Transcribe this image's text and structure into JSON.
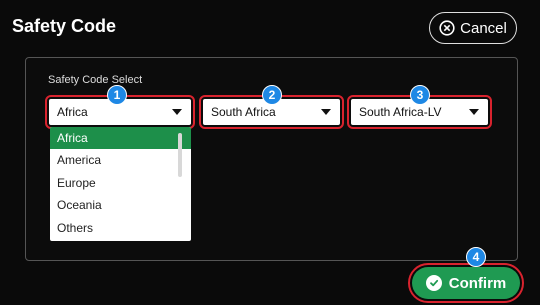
{
  "header": {
    "title": "Safety Code",
    "cancel_label": "Cancel"
  },
  "panel": {
    "label": "Safety Code  Select"
  },
  "selects": [
    {
      "value": "Africa",
      "badge": "1"
    },
    {
      "value": "South Africa",
      "badge": "2"
    },
    {
      "value": "South Africa-LV",
      "badge": "3"
    }
  ],
  "dropdown": {
    "options": [
      "Africa",
      "America",
      "Europe",
      "Oceania",
      "Others"
    ],
    "selected": "Africa"
  },
  "confirm": {
    "label": "Confirm",
    "badge": "4"
  },
  "colors": {
    "accent_green": "#1f9a52",
    "highlight_red": "#d9232e",
    "badge_blue": "#1e88e5"
  }
}
